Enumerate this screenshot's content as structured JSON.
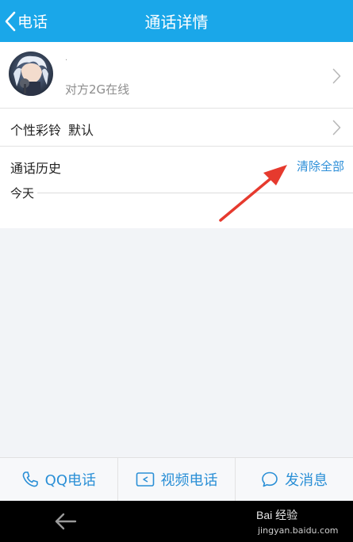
{
  "header": {
    "back_label": "电话",
    "title": "通话详情"
  },
  "contact": {
    "name": "·",
    "status": "对方2G在线"
  },
  "ringtone": {
    "label": "个性彩铃",
    "value": "默认"
  },
  "history": {
    "label": "通话历史",
    "clear_label": "清除全部",
    "today_label": "今天"
  },
  "actions": [
    {
      "label": "QQ电话",
      "icon": "phone-icon"
    },
    {
      "label": "视频电话",
      "icon": "video-icon"
    },
    {
      "label": "发消息",
      "icon": "message-icon"
    }
  ],
  "watermark": {
    "main": "Bai 经验",
    "sub": "jingyan.baidu.com"
  },
  "colors": {
    "header_bg": "#1aa7e9",
    "accent_blue": "#2a8fd6",
    "annotation_red": "#e63a2e"
  }
}
